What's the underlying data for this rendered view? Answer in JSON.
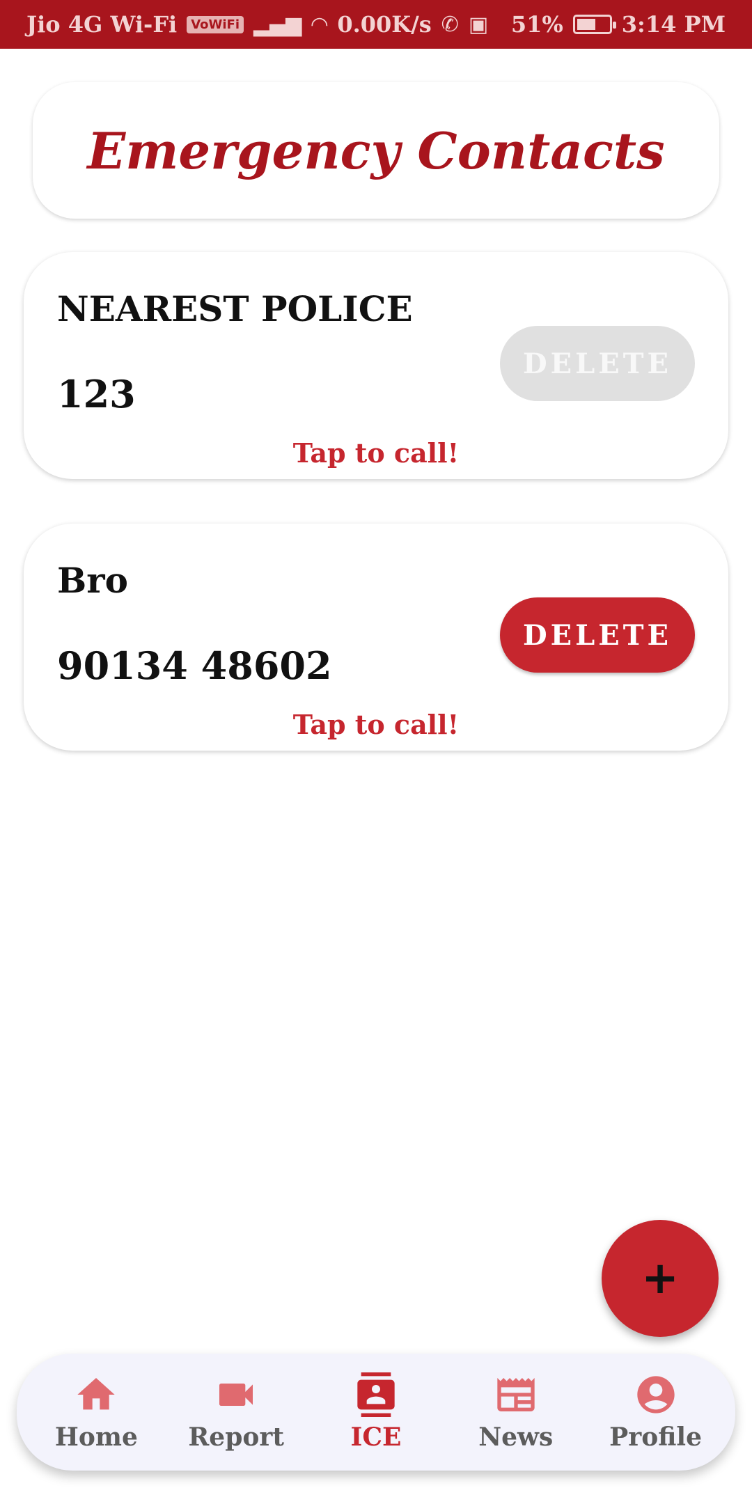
{
  "status_bar": {
    "carrier": "Jio 4G Wi-Fi",
    "vowifi": "VoWiFi",
    "speed": "0.00K/s",
    "battery": "51%",
    "time": "3:14 PM"
  },
  "header": {
    "title": "Emergency Contacts"
  },
  "contacts": [
    {
      "name": "NEAREST POLICE",
      "number": "123",
      "delete_label": "DELETE",
      "delete_enabled": false,
      "tap_hint": "Tap to call!"
    },
    {
      "name": "Bro",
      "number": "90134 48602",
      "delete_label": "DELETE",
      "delete_enabled": true,
      "tap_hint": "Tap to call!"
    }
  ],
  "fab": {
    "label": "+",
    "icon": "add-icon"
  },
  "bottom_nav": {
    "items": [
      {
        "label": "Home",
        "icon": "home-icon",
        "active": false
      },
      {
        "label": "Report",
        "icon": "video-camera-icon",
        "active": false
      },
      {
        "label": "ICE",
        "icon": "contact-book-icon",
        "active": true
      },
      {
        "label": "News",
        "icon": "newspaper-icon",
        "active": false
      },
      {
        "label": "Profile",
        "icon": "account-circle-icon",
        "active": false
      }
    ]
  },
  "colors": {
    "brand": "#a8151d",
    "accent": "#c6262e",
    "icon_inactive": "#e06a6f",
    "nav_background": "#f3f3fc"
  }
}
